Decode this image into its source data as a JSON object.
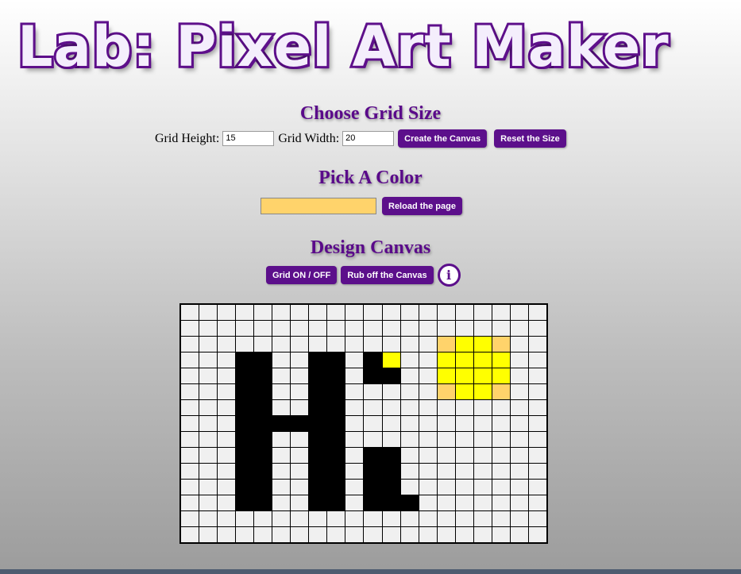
{
  "title": "Lab: Pixel Art Maker",
  "grid_size": {
    "heading": "Choose Grid Size",
    "height_label": "Grid Height:",
    "height_value": "15",
    "width_label": "Grid Width:",
    "width_value": "20",
    "create_label": "Create the Canvas",
    "reset_label": "Reset the Size"
  },
  "color": {
    "heading": "Pick A Color",
    "value": "#ffd36b",
    "reload_label": "Reload the page"
  },
  "design": {
    "heading": "Design Canvas",
    "grid_toggle_label": "Grid ON / OFF",
    "rub_label": "Rub off the Canvas",
    "info_icon": "info-icon"
  },
  "canvas": {
    "rows": 15,
    "cols": 20,
    "background": "#f0f0f0",
    "palette": {
      "K": "#000000",
      "Y": "#ffff00",
      "O": "#ffd36b"
    },
    "pixels": [
      "....................",
      "....................",
      "..............OYYO..",
      "...KK..KK.KY..YYYY..",
      "...KK..KK.KK..YYYY..",
      "...KK..KK.....OYYO..",
      "...KK..KK...........",
      "...KKKKKK...........",
      "...KK..KK...........",
      "...KK..KK.KK........",
      "...KK..KK.KK........",
      "...KK..KK.KK........",
      "...KK..KK.KKK.......",
      "....................",
      "...................."
    ]
  }
}
